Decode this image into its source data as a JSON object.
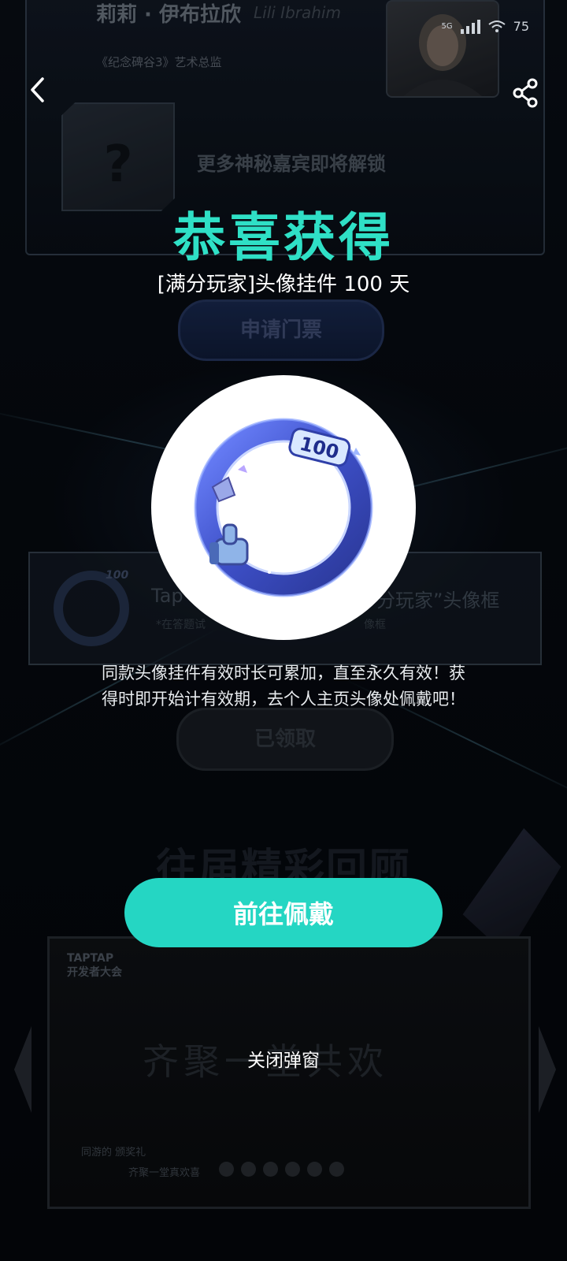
{
  "status_bar": {
    "network": "5G",
    "battery": "75"
  },
  "background": {
    "guest": {
      "name_cn": "莉莉 · 伊布拉欣",
      "name_en": "Lili Ibrahim",
      "role": "《纪念碑谷3》艺术总监"
    },
    "mystery": {
      "mark": "?",
      "text": "更多神秘嘉宾即将解锁"
    },
    "ticket_button": "申请门票",
    "frame_card": {
      "title_part1": "Tap",
      "title_part2": "分玩家”头像框",
      "note": "*在答题试",
      "note_end": "像框",
      "badge": "100"
    },
    "claimed_button": "已领取",
    "review_title": "往届精彩回顾",
    "video": {
      "logo_line1": "TAPTAP",
      "logo_line2": "开发者大会",
      "callig": "齐聚一堂共欢",
      "foot1": "同游的  颁奖礼",
      "foot2": "齐聚一堂真欢喜"
    }
  },
  "modal": {
    "title": "恭喜获得",
    "reward_name": "[满分玩家]头像挂件 100 天",
    "badge": "100",
    "description": "同款头像挂件有效时长可累加，直至永久有效！获得时即开始计有效期，去个人主页头像处佩戴吧！",
    "primary_button": "前往佩戴",
    "close_label": "关闭弹窗"
  },
  "carousel": {
    "page_count": 6
  },
  "colors": {
    "accent": "#25d6c3",
    "title": "#2fe0c6",
    "ring": "#3d4fc7"
  }
}
